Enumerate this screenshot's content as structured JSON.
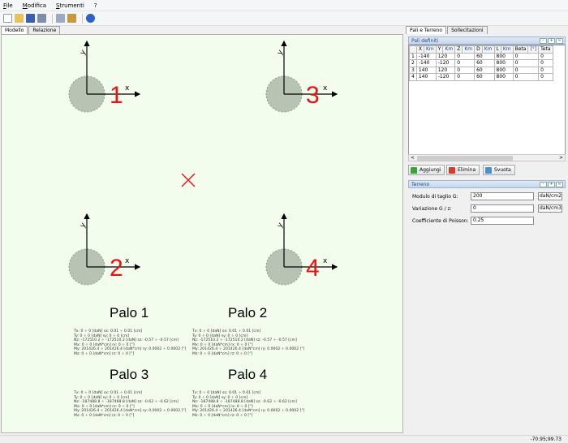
{
  "menu": [
    "File",
    "Modifica",
    "Strumenti",
    "?"
  ],
  "toolbar_icons": [
    "new-file-icon",
    "open-folder-icon",
    "save-icon",
    "print-icon",
    "copy-icon",
    "print-preview-icon",
    "help-icon"
  ],
  "left_tabs": [
    "Modello",
    "Relazione"
  ],
  "right_tabs": [
    "Pali e Terreno",
    "Sollecitazioni"
  ],
  "piles": [
    {
      "number": "1",
      "axis_x": "x",
      "axis_y": "y"
    },
    {
      "number": "2",
      "axis_x": "x",
      "axis_y": "y"
    },
    {
      "number": "3",
      "axis_x": "x",
      "axis_y": "y"
    },
    {
      "number": "4",
      "axis_x": "x",
      "axis_y": "y"
    }
  ],
  "results": [
    {
      "title": "Palo 1",
      "lines": [
        "Tx: 0 ÷ 0 [daN] sx: 0.01 ÷ 0.01 [cm]",
        "Ty: 0 ÷ 0 [daN] sy: 0 ÷ 0 [cm]",
        "Nz: -172510.2 ÷ -172510.2 [daN] sz: -0.57 ÷ -0.57 [cm]",
        "Mx: 0 ÷ 0 [daN*cm] rx: 0 ÷ 0 [°]",
        "My: 201426.4 ÷ 201426.4 [daN*cm] ry: 0.0002 ÷ 0.0002 [°]",
        "Mz: 0 ÷ 0 [daN*cm] rz: 0 ÷ 0 [°]"
      ]
    },
    {
      "title": "Palo 2",
      "lines": [
        "Tx: 0 ÷ 0 [daN] sx: 0.01 ÷ 0.01 [cm]",
        "Ty: 0 ÷ 0 [daN] sy: 0 ÷ 0 [cm]",
        "Nz: -172510.2 ÷ -172510.2 [daN] sz: -0.57 ÷ -0.57 [cm]",
        "Mx: 0 ÷ 0 [daN*cm] rx: 0 ÷ 0 [°]",
        "My: 201426.4 ÷ 201426.4 [daN*cm] ry: 0.0002 ÷ 0.0002 [°]",
        "Mz: 0 ÷ 0 [daN*cm] rz: 0 ÷ 0 [°]"
      ]
    },
    {
      "title": "Palo 3",
      "lines": [
        "Tx: 0 ÷ 0 [daN] sx: 0.01 ÷ 0.01 [cm]",
        "Ty: 0 ÷ 0 [daN] sy: 0 ÷ 0 [cm]",
        "Nz: -187488.8 ÷ -187488.8 [daN] sz: -0.62 ÷ -0.62 [cm]",
        "Mx: 0 ÷ 0 [daN*cm] rx: 0 ÷ 0 [°]",
        "My: 201426.4 ÷ 201426.4 [daN*cm] ry: 0.0002 ÷ 0.0002 [°]",
        "Mz: 0 ÷ 0 [daN*cm] rz: 0 ÷ 0 [°]"
      ]
    },
    {
      "title": "Palo 4",
      "lines": [
        "Tx: 0 ÷ 0 [daN] sx: 0.01 ÷ 0.01 [cm]",
        "Ty: 0 ÷ 0 [daN] sy: 0 ÷ 0 [cm]",
        "Nz: -187488.8 ÷ -187488.8 [daN] sz: -0.62 ÷ -0.62 [cm]",
        "Mx: 0 ÷ 0 [daN*cm] rx: 0 ÷ 0 [°]",
        "My: 201426.4 ÷ 201426.4 [daN*cm] ry: 0.0002 ÷ 0.0002 [°]",
        "Mz: 0 ÷ 0 [daN*cm] rz: 0 ÷ 0 [°]"
      ]
    }
  ],
  "pali_definiti": {
    "title": "Pali definiti",
    "header_btns": [
      "-",
      "+",
      "≈"
    ],
    "columns": [
      "X",
      "Km",
      "Y",
      "Km",
      "Z",
      "Km",
      "D",
      "Km",
      "L",
      "Km",
      "Beta",
      "[°]",
      "Teta"
    ],
    "rows": [
      [
        "1",
        "-140",
        "120",
        "0",
        "60",
        "800",
        "0",
        "0"
      ],
      [
        "2",
        "-140",
        "-120",
        "0",
        "60",
        "800",
        "0",
        "0"
      ],
      [
        "3",
        "140",
        "120",
        "0",
        "60",
        "800",
        "0",
        "0"
      ],
      [
        "4",
        "140",
        "-120",
        "0",
        "60",
        "800",
        "0",
        "0"
      ]
    ],
    "scroll_left": "<",
    "scroll_right": ">",
    "buttons": {
      "add": "Aggiungi",
      "delete": "Elimina",
      "clear": "Svuota"
    }
  },
  "terreno": {
    "title": "Terreno",
    "header_btns": [
      "-",
      "+",
      "≈"
    ],
    "fields": [
      {
        "label": "Modulo di taglio G:",
        "value": "200",
        "unit": "daN/cm2"
      },
      {
        "label": "Variazione G / z:",
        "value": "0",
        "unit": "daN/cm3"
      },
      {
        "label": "Coefficiente di Poisson:",
        "value": "0.25",
        "unit": ""
      }
    ]
  },
  "status": {
    "coords": "-70.95;99.73"
  },
  "colors": {
    "pile_fill": "#b7c4b4",
    "pile_number": "#ee1111",
    "cross": "#ee1111",
    "canvas_bg": "#f2fdee"
  }
}
